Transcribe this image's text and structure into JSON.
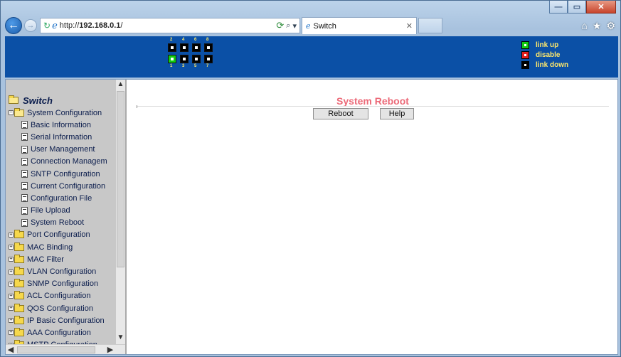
{
  "browser": {
    "address_url_prefix": "http://",
    "address_url_host": "192.168.0.1",
    "address_url_suffix": "/",
    "tab_title": "Switch"
  },
  "banner": {
    "port_numbers_top": [
      "2",
      "4",
      "6",
      "8"
    ],
    "port_numbers_bottom": [
      "1",
      "3",
      "5",
      "7"
    ],
    "port_status_top": [
      "link down",
      "link down",
      "link down",
      "link down"
    ],
    "port_status_bottom": [
      "link up",
      "link down",
      "link down",
      "link down"
    ],
    "legend": [
      {
        "label": "link up",
        "color": "#11cc11"
      },
      {
        "label": "disable",
        "color": "#e21d1d"
      },
      {
        "label": "link down",
        "color": "#000000"
      }
    ]
  },
  "sidebar": {
    "root_label": "Switch",
    "system_configuration": "System Configuration",
    "system_items": [
      "Basic Information",
      "Serial Information",
      "User Management",
      "Connection Managem",
      "SNTP Configuration",
      "Current Configuration",
      "Configuration File",
      "File Upload",
      "System Reboot"
    ],
    "folders": [
      "Port Configuration",
      "MAC Binding",
      "MAC Filter",
      "VLAN Configuration",
      "SNMP Configuration",
      "ACL Configuration",
      "QOS Configuration",
      "IP Basic Configuration",
      "AAA Configuration",
      "MSTP Configuration"
    ]
  },
  "main": {
    "title": "System Reboot",
    "reboot_button": "Reboot",
    "help_button": "Help"
  },
  "colors": {
    "banner_bg": "#0b50a6",
    "title_color": "#ec6a78",
    "legend_text": "#ffe86a"
  }
}
